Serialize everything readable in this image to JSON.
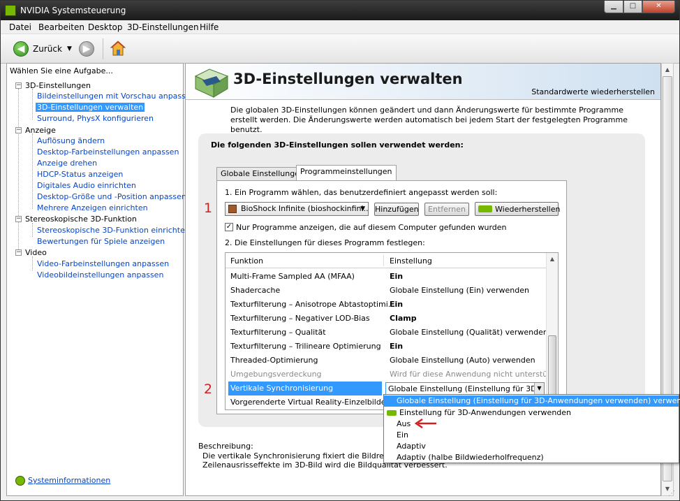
{
  "window": {
    "title": "NVIDIA Systemsteuerung"
  },
  "menu": [
    "Datei",
    "Bearbeiten",
    "Desktop",
    "3D-Einstellungen",
    "Hilfe"
  ],
  "toolbar": {
    "back_label": "Zurück"
  },
  "sidebar": {
    "heading": "Wählen Sie eine Aufgabe...",
    "groups": [
      {
        "label": "3D-Einstellungen",
        "items": [
          "Bildeinstellungen mit Vorschau anpassen",
          "3D-Einstellungen verwalten",
          "Surround, PhysX konfigurieren"
        ]
      },
      {
        "label": "Anzeige",
        "items": [
          "Auflösung ändern",
          "Desktop-Farbeinstellungen anpassen",
          "Anzeige drehen",
          "HDCP-Status anzeigen",
          "Digitales Audio einrichten",
          "Desktop-Größe und -Position anpassen",
          "Mehrere Anzeigen einrichten"
        ]
      },
      {
        "label": "Stereoskopische 3D-Funktion",
        "items": [
          "Stereoskopische 3D-Funktion einrichten",
          "Bewertungen für Spiele anzeigen"
        ]
      },
      {
        "label": "Video",
        "items": [
          "Video-Farbeinstellungen anpassen",
          "Videobildeinstellungen anpassen"
        ]
      }
    ],
    "selected": "3D-Einstellungen verwalten",
    "system_info": "Systeminformationen"
  },
  "main": {
    "title": "3D-Einstellungen verwalten",
    "restore_defaults": "Standardwerte wiederherstellen",
    "intro": "Die globalen 3D-Einstellungen können geändert und dann Änderungswerte für bestimmte Programme erstellt werden. Die Änderungswerte werden automatisch bei jedem Start der festgelegten Programme benutzt.",
    "panel_heading": "Die folgenden 3D-Einstellungen sollen verwendet werden:",
    "tabs": [
      "Globale Einstellungen",
      "Programmeinstellungen"
    ],
    "active_tab": "Programmeinstellungen",
    "step1": "1. Ein Programm wählen, das benutzerdefiniert angepasst werden soll:",
    "program": "BioShock Infinite (bioshockinfini...",
    "add_button": "Hinzufügen",
    "remove_button": "Entfernen",
    "restore_button": "Wiederherstellen",
    "checkbox_label": "Nur Programme anzeigen, die auf diesem Computer gefunden wurden",
    "checkbox_checked": true,
    "step2": "2. Die Einstellungen für dieses Programm festlegen:",
    "columns": [
      "Funktion",
      "Einstellung"
    ],
    "rows": [
      {
        "f": "Multi-Frame Sampled AA (MFAA)",
        "v": "Ein",
        "bold": true
      },
      {
        "f": "Shadercache",
        "v": "Globale Einstellung (Ein) verwenden",
        "bold": false
      },
      {
        "f": "Texturfilterung – Anisotrope Abtastoptimi...",
        "v": "Ein",
        "bold": true
      },
      {
        "f": "Texturfilterung – Negativer LOD-Bias",
        "v": "Clamp",
        "bold": true
      },
      {
        "f": "Texturfilterung – Qualität",
        "v": "Globale Einstellung (Qualität) verwenden",
        "bold": false
      },
      {
        "f": "Texturfilterung – Trilineare Optimierung",
        "v": "Ein",
        "bold": true
      },
      {
        "f": "Threaded-Optimierung",
        "v": "Globale Einstellung (Auto) verwenden",
        "bold": false
      },
      {
        "f": "Umgebungsverdeckung",
        "v": "Wird für diese Anwendung nicht unterstützt",
        "bold": false,
        "disabled": true
      },
      {
        "f": "Vertikale Synchronisierung",
        "v": "Globale Einstellung (Einstellung für 3D-Anwe",
        "bold": false,
        "selected": true
      },
      {
        "f": "Vorgerenderte Virtual Reality-Einzelbilder",
        "v": "",
        "bold": false
      }
    ],
    "markers": [
      "1",
      "2"
    ],
    "description_label": "Beschreibung:",
    "description_text": "Die vertikale Synchronisierung fixiert die Bildrendering-Rate... Durch die Eliminierung der horizontalen Zeilenausrisseffekte im 3D-Bild wird die Bildqualität verbessert."
  },
  "vsync_dropdown": {
    "options": [
      "Globale Einstellung (Einstellung für 3D-Anwendungen verwenden) verwenden",
      "Einstellung für 3D-Anwendungen verwenden",
      "Aus",
      "Ein",
      "Adaptiv",
      "Adaptiv (halbe Bildwiederholfrequenz)"
    ],
    "highlighted": "Globale Einstellung (Einstellung für 3D-Anwendungen verwenden) verwenden"
  },
  "colors": {
    "nvidia_green": "#76b900",
    "selection_blue": "#3399ff",
    "link_blue": "#0645c8",
    "marker_red": "#d02020"
  }
}
